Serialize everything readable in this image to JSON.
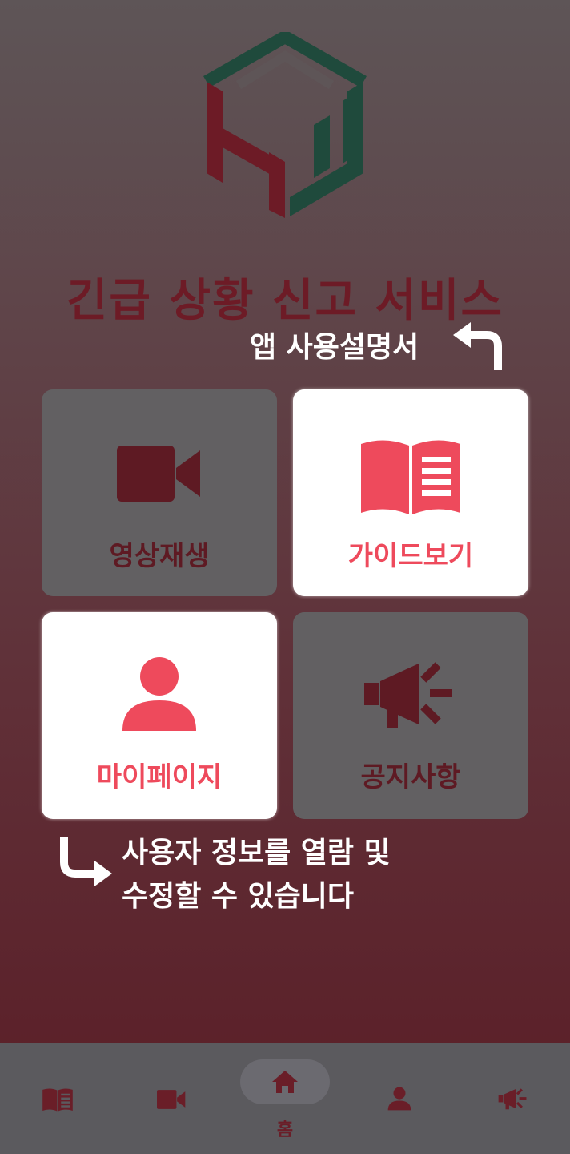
{
  "app": {
    "title": "긴급 상황 신고 서비스",
    "help_hint": "앱 사용설명서",
    "mypage_hint_line1": "사용자 정보를 열람 및",
    "mypage_hint_line2": "수정할 수 있습니다"
  },
  "tiles": {
    "video": {
      "label": "영상재생",
      "icon": "video-camera-icon",
      "highlighted": false
    },
    "guide": {
      "label": "가이드보기",
      "icon": "book-icon",
      "highlighted": true
    },
    "mypage": {
      "label": "마이페이지",
      "icon": "user-icon",
      "highlighted": true
    },
    "notice": {
      "label": "공지사항",
      "icon": "megaphone-icon",
      "highlighted": false
    }
  },
  "bottom_nav": {
    "items": [
      {
        "icon": "book-icon",
        "label": ""
      },
      {
        "icon": "video-camera-icon",
        "label": ""
      },
      {
        "icon": "home-icon",
        "label": "홈",
        "active": true
      },
      {
        "icon": "user-icon",
        "label": ""
      },
      {
        "icon": "megaphone-icon",
        "label": ""
      }
    ]
  },
  "colors": {
    "accent": "#ee4a5c",
    "dark_red": "#6d1b26",
    "logo_green": "#1f4a3c",
    "tile_gray": "#626062"
  }
}
